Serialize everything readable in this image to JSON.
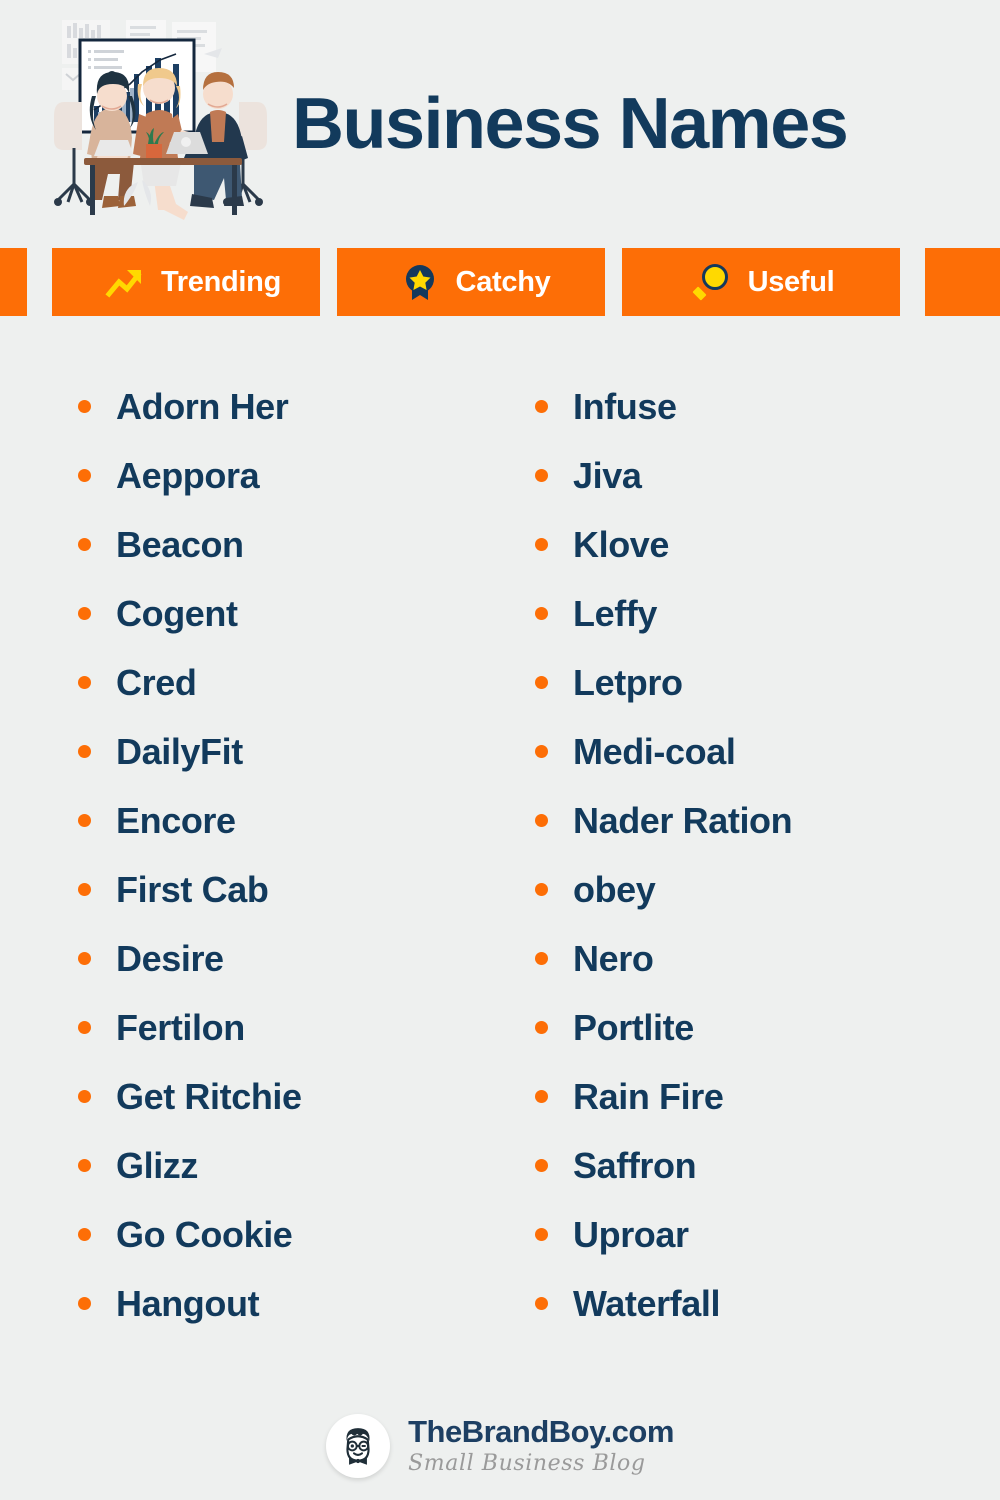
{
  "header": {
    "title": "Business Names",
    "illustration_name": "business-meeting-illustration"
  },
  "colors": {
    "background": "#eef0ef",
    "accent_orange": "#fd6e06",
    "navy": "#123a5c",
    "yellow": "#ffd900",
    "white": "#ffffff"
  },
  "tabs": [
    {
      "label": "Trending",
      "icon": "trending-up-icon"
    },
    {
      "label": "Catchy",
      "icon": "star-badge-icon"
    },
    {
      "label": "Useful",
      "icon": "magnifier-icon"
    }
  ],
  "names": {
    "left_column": [
      "Adorn Her",
      "Aeppora",
      "Beacon",
      "Cogent",
      "Cred",
      "DailyFit",
      "Encore",
      "First Cab",
      "Desire",
      "Fertilon",
      "Get Ritchie",
      "Glizz",
      "Go Cookie",
      "Hangout"
    ],
    "right_column": [
      "Infuse",
      "Jiva",
      "Klove",
      "Leffy",
      "Letpro",
      "Medi-coal",
      "Nader Ration",
      "obey",
      "Nero",
      "Portlite",
      "Rain Fire",
      "Saffron",
      "Uproar",
      "Waterfall"
    ]
  },
  "footer": {
    "brand": "TheBrandBoy.com",
    "tagline": "Small Business Blog",
    "logo_name": "brandboy-avatar-icon"
  }
}
